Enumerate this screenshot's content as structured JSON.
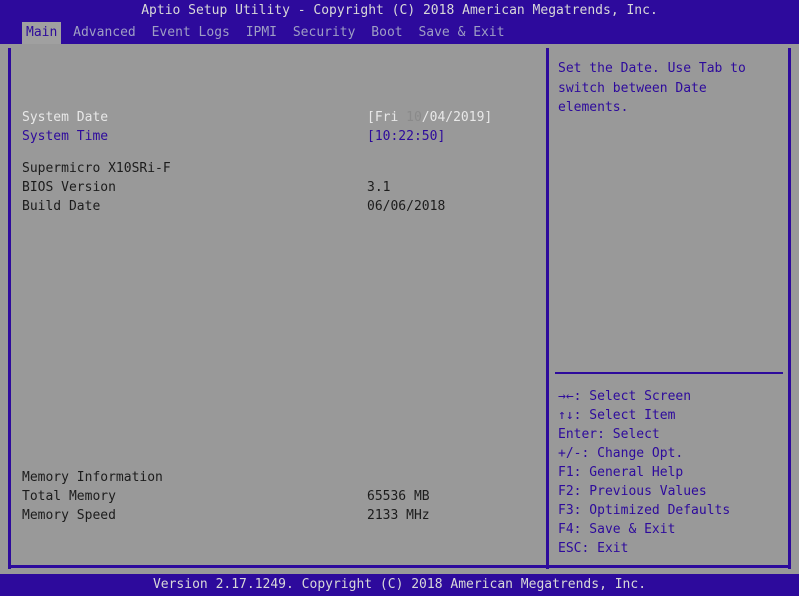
{
  "titlebar": {
    "text": "Aptio Setup Utility - Copyright (C) 2018 American Megatrends, Inc."
  },
  "menubar": {
    "items": [
      {
        "label": "Main",
        "active": true
      },
      {
        "label": "Advanced",
        "active": false
      },
      {
        "label": "Event Logs",
        "active": false
      },
      {
        "label": "IPMI",
        "active": false
      },
      {
        "label": "Security",
        "active": false
      },
      {
        "label": "Boot",
        "active": false
      },
      {
        "label": "Save & Exit",
        "active": false
      }
    ]
  },
  "main": {
    "rows": [
      {
        "label": "System Date",
        "value_prefix": "[Fri ",
        "value_selected": "10",
        "value_suffix": "/04/2019]",
        "state": "selected"
      },
      {
        "label": "System Time",
        "value": "[10:22:50]",
        "state": "normal"
      },
      {
        "label": "Supermicro X10SRi-F",
        "value": "",
        "state": "heading"
      },
      {
        "label": "BIOS Version",
        "value": "3.1",
        "state": "static"
      },
      {
        "label": "Build Date",
        "value": "06/06/2018",
        "state": "static"
      },
      {
        "label": "Memory Information",
        "value": "",
        "state": "heading"
      },
      {
        "label": "Total Memory",
        "value": "65536 MB",
        "state": "static"
      },
      {
        "label": "Memory Speed",
        "value": "2133 MHz",
        "state": "static"
      }
    ]
  },
  "help": {
    "text": "Set the Date. Use Tab to switch between Date elements."
  },
  "keys": {
    "items": [
      {
        "key": "→←",
        "sep": ":",
        "action": " Select Screen"
      },
      {
        "key": "↑↓",
        "sep": ":",
        "action": " Select Item"
      },
      {
        "key": "Enter",
        "sep": ":",
        "action": " Select"
      },
      {
        "key": "+/-",
        "sep": ":",
        "action": " Change Opt."
      },
      {
        "key": "F1",
        "sep": ":",
        "action": " General Help"
      },
      {
        "key": "F2",
        "sep": ":",
        "action": " Previous Values"
      },
      {
        "key": "F3",
        "sep": ":",
        "action": " Optimized Defaults"
      },
      {
        "key": "F4",
        "sep": ":",
        "action": " Save & Exit"
      },
      {
        "key": "ESC",
        "sep": ":",
        "action": " Exit"
      }
    ]
  },
  "footer": {
    "text": "Version 2.17.1249. Copyright (C) 2018 American Megatrends, Inc."
  },
  "colors": {
    "chrome_blue": "#2d0a9c",
    "panel_gray": "#999999",
    "tab_active_bg": "#a0a0a0",
    "text_white": "#e8e8e8",
    "text_dark": "#1c1c1c",
    "menu_inactive": "#9e9ec4"
  }
}
